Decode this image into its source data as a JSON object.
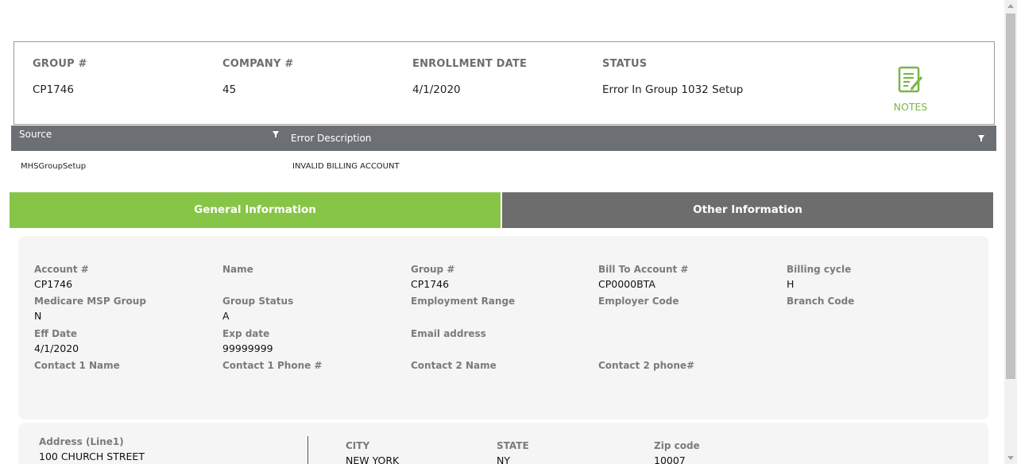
{
  "summary": {
    "group_label": "GROUP #",
    "group_value": "CP1746",
    "company_label": "COMPANY #",
    "company_value": "45",
    "enroll_label": "ENROLLMENT DATE",
    "enroll_value": "4/1/2020",
    "status_label": "STATUS",
    "status_value": "Error In Group 1032 Setup",
    "notes_label": "NOTES",
    "notes_icon": "notes-icon"
  },
  "errors": {
    "columns": [
      "Source",
      "Error Description"
    ],
    "rows": [
      {
        "source": "MHSGroupSetup",
        "description": "INVALID BILLING ACCOUNT"
      }
    ]
  },
  "tabs": [
    {
      "label": "General Information",
      "active": true
    },
    {
      "label": "Other Information",
      "active": false
    }
  ],
  "general": {
    "account_label": "Account #",
    "account_value": "CP1746",
    "name_label": "Name",
    "name_value": "",
    "group_label": "Group #",
    "group_value": "CP1746",
    "billto_label": "Bill To Account #",
    "billto_value": "CP0000BTA",
    "cycle_label": "Billing cycle",
    "cycle_value": "H",
    "msp_label": "Medicare MSP Group",
    "msp_value": "N",
    "gstatus_label": "Group Status",
    "gstatus_value": "A",
    "emprange_label": "Employment Range",
    "emprange_value": "",
    "empcode_label": "Employer Code",
    "empcode_value": "",
    "branch_label": "Branch Code",
    "branch_value": "",
    "eff_label": "Eff Date",
    "eff_value": "4/1/2020",
    "exp_label": "Exp date",
    "exp_value": "99999999",
    "email_label": "Email address",
    "email_value": "",
    "c1name_label": "Contact 1 Name",
    "c1name_value": "",
    "c1phone_label": "Contact 1 Phone #",
    "c1phone_value": "",
    "c2name_label": "Contact 2 Name",
    "c2name_value": "",
    "c2phone_label": "Contact 2 phone#",
    "c2phone_value": ""
  },
  "address": {
    "line1_label": "Address (Line1)",
    "line1_value": "100 CHURCH STREET",
    "city_label": "CITY",
    "city_value": "NEW YORK",
    "state_label": "STATE",
    "state_value": "NY",
    "zip_label": "Zip code",
    "zip_value": "10007"
  },
  "colors": {
    "accent_green": "#87c547",
    "tab_inactive": "#6d6d6d",
    "grid_header": "#6c7075"
  }
}
